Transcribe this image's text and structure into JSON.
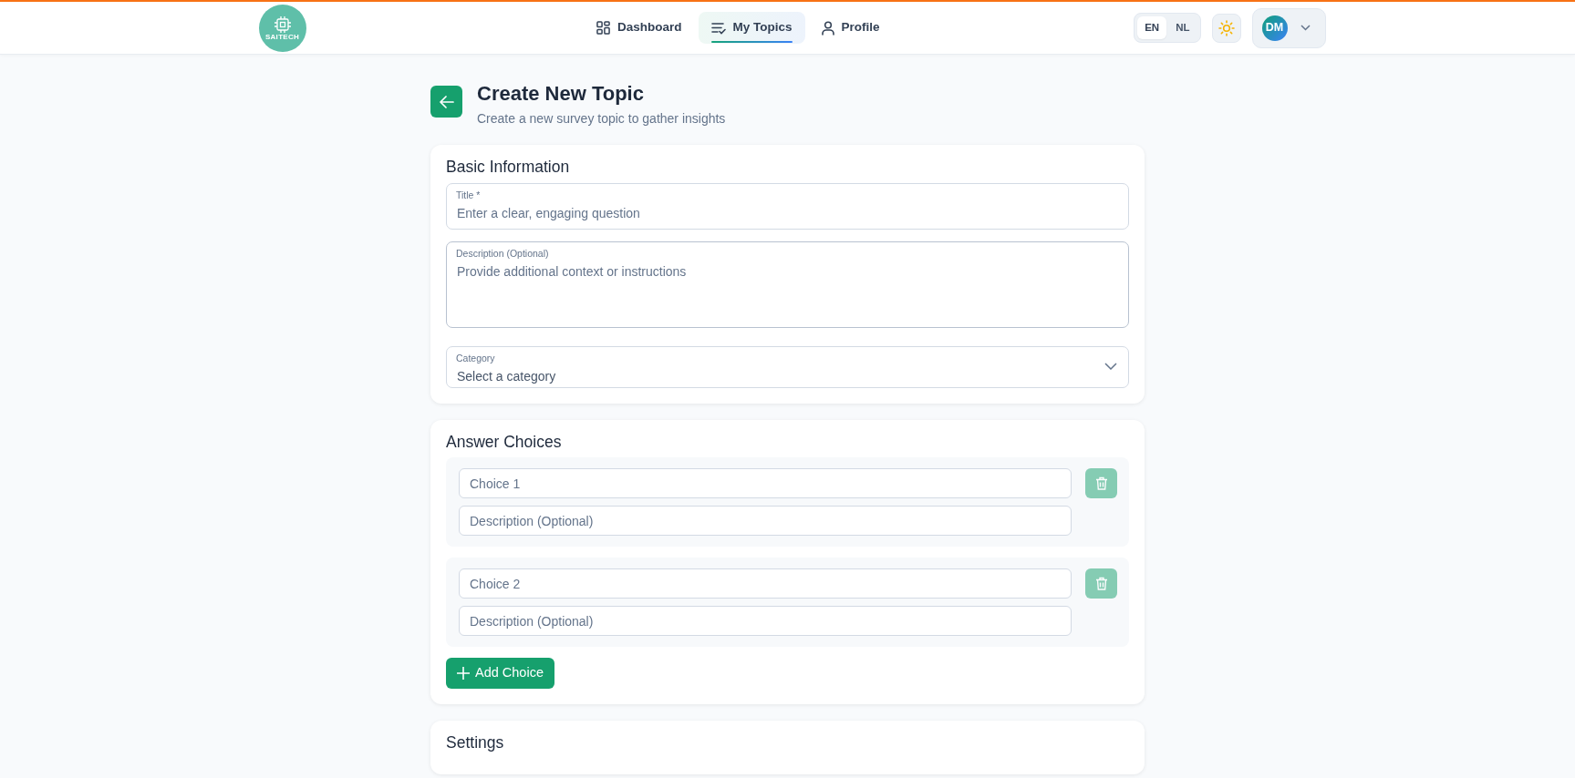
{
  "navbar": {
    "logo": {
      "text": "SAITECH"
    },
    "nav": [
      {
        "label": "Dashboard",
        "kind": "grid",
        "selected": false
      },
      {
        "label": "My Topics",
        "kind": "list-check",
        "selected": true
      },
      {
        "label": "Profile",
        "kind": "person",
        "selected": false
      }
    ],
    "languages": [
      {
        "label": "EN",
        "selected": true
      },
      {
        "label": "NL",
        "selected": false
      }
    ],
    "user": {
      "initials": "DM"
    }
  },
  "header": {
    "title": "Create New Topic",
    "subtitle": "Create a new survey topic to gather insights"
  },
  "sections": [
    {
      "title": "Basic Information",
      "fields": [
        {
          "kind": "text",
          "label": "Title *",
          "placeholder": "Enter a clear, engaging question"
        },
        {
          "kind": "textarea",
          "label": "Description (Optional)",
          "placeholder": "Provide additional context or instructions"
        },
        {
          "kind": "select",
          "label": "Category",
          "value": "Select a category"
        }
      ]
    },
    {
      "title": "Answer Choices",
      "choices": [
        {
          "placeholder": "Choice 1",
          "description_placeholder": "Description (Optional)",
          "delete_disabled": true
        },
        {
          "placeholder": "Choice 2",
          "description_placeholder": "Description (Optional)",
          "delete_disabled": true
        }
      ],
      "add_button": "Add Choice"
    },
    {
      "title": "Settings"
    }
  ]
}
